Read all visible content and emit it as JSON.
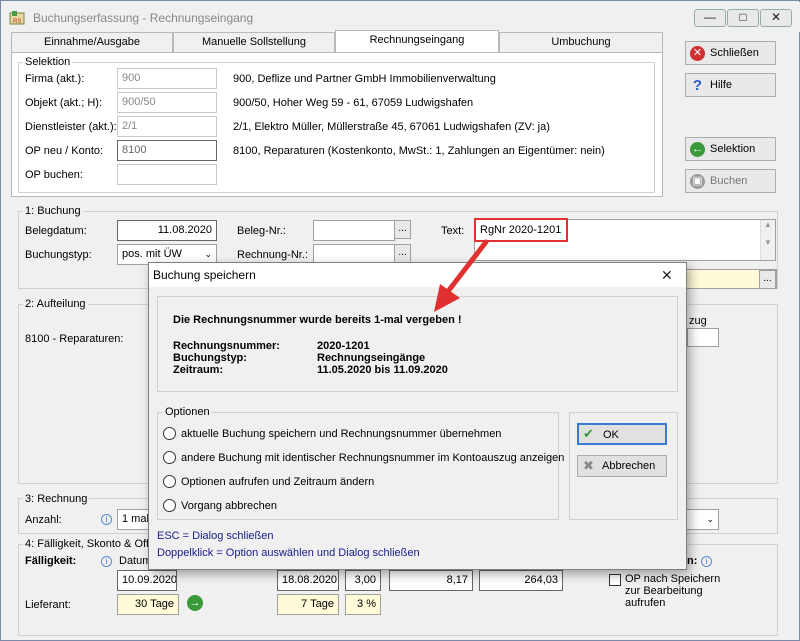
{
  "window": {
    "title": "Buchungserfassung - Rechnungseingang",
    "btn_min": "—",
    "btn_max": "□",
    "btn_close": "✕"
  },
  "tabs": [
    "Einnahme/Ausgabe",
    "Manuelle Sollstellung",
    "Rechnungseingang",
    "Umbuchung"
  ],
  "selektion": {
    "legend": "Selektion",
    "rows": [
      {
        "label": "Firma (akt.):",
        "value": "900",
        "desc": "900,  Deflize und Partner GmbH Immobilienverwaltung"
      },
      {
        "label": "Objekt (akt.; H):",
        "value": "900/50",
        "desc": "900/50,  Hoher Weg 59 - 61, 67059 Ludwigshafen"
      },
      {
        "label": "Dienstleister (akt.):",
        "value": "2/1",
        "desc": "2/1,  Elektro Müller,  Müllerstraße 45, 67061 Ludwigshafen  (ZV: ja)"
      },
      {
        "label": "OP neu / Konto:",
        "value": "8100",
        "desc": "8100,  Reparaturen  (Kostenkonto,  MwSt.: 1,  Zahlungen an Eigentümer: nein)"
      },
      {
        "label": "OP buchen:",
        "value": "",
        "desc": ""
      }
    ]
  },
  "side_buttons": {
    "close": "Schließen",
    "help": "Hilfe",
    "selection": "Selektion",
    "book": "Buchen"
  },
  "buchung": {
    "legend": "1: Buchung",
    "belegdatum_label": "Belegdatum:",
    "belegdatum": "11.08.2020",
    "belegnr_label": "Beleg-Nr.:",
    "text_label": "Text:",
    "text_value": "RgNr 2020-1201",
    "buchungstyp_label": "Buchungstyp:",
    "buchungstyp": "pos. mit ÜW",
    "rechnungnr_label": "Rechnung-Nr.:",
    "browse": "..."
  },
  "aufteilung": {
    "legend": "2: Aufteilung",
    "row_label": "8100 - Reparaturen:",
    "right_label_fragment": "zug"
  },
  "rechnung": {
    "legend": "3: Rechnung",
    "anzahl_label": "Anzahl:",
    "anzahl_value": "1 mal"
  },
  "faelligkeit": {
    "legend": "4: Fälligkeit, Skonto & Offe",
    "faelligkeit_label": "Fälligkeit:",
    "datum_label": "Datum",
    "n_suffix": "n:",
    "datum": "10.09.2020",
    "date2": "18.08.2020",
    "pct": "3,00",
    "amount1": "8,17",
    "amount2": "264,03",
    "op_checkbox_label": "OP nach Speichern zur Bearbeitung aufrufen",
    "lieferant_label": "Lieferant:",
    "lieferant_tage": "30 Tage",
    "tage2": "7 Tage",
    "pct2": "3 %"
  },
  "dialog": {
    "title": "Buchung speichern",
    "message": "Die Rechnungsnummer wurde bereits 1-mal vergeben !",
    "details": [
      {
        "label": "Rechnungsnummer:",
        "value": "2020-1201"
      },
      {
        "label": "Buchungstyp:",
        "value": "Rechnungseingänge"
      },
      {
        "label": "Zeitraum:",
        "value": "11.05.2020 bis 11.09.2020"
      }
    ],
    "options_legend": "Optionen",
    "options": [
      "aktuelle Buchung speichern und Rechnungsnummer übernehmen",
      "andere Buchung mit identischer Rechnungsnummer im Kontoauszug anzeigen",
      "Optionen aufrufen und Zeitraum ändern",
      "Vorgang abbrechen"
    ],
    "ok": "OK",
    "cancel": "Abbrechen",
    "hint1": "ESC = Dialog schließen",
    "hint2": "Doppelklick = Option auswählen und Dialog schließen"
  },
  "colors": {
    "highlight_red": "#e03030",
    "hint_blue": "#1a1a8a",
    "yellow_field": "#fffbd8"
  }
}
